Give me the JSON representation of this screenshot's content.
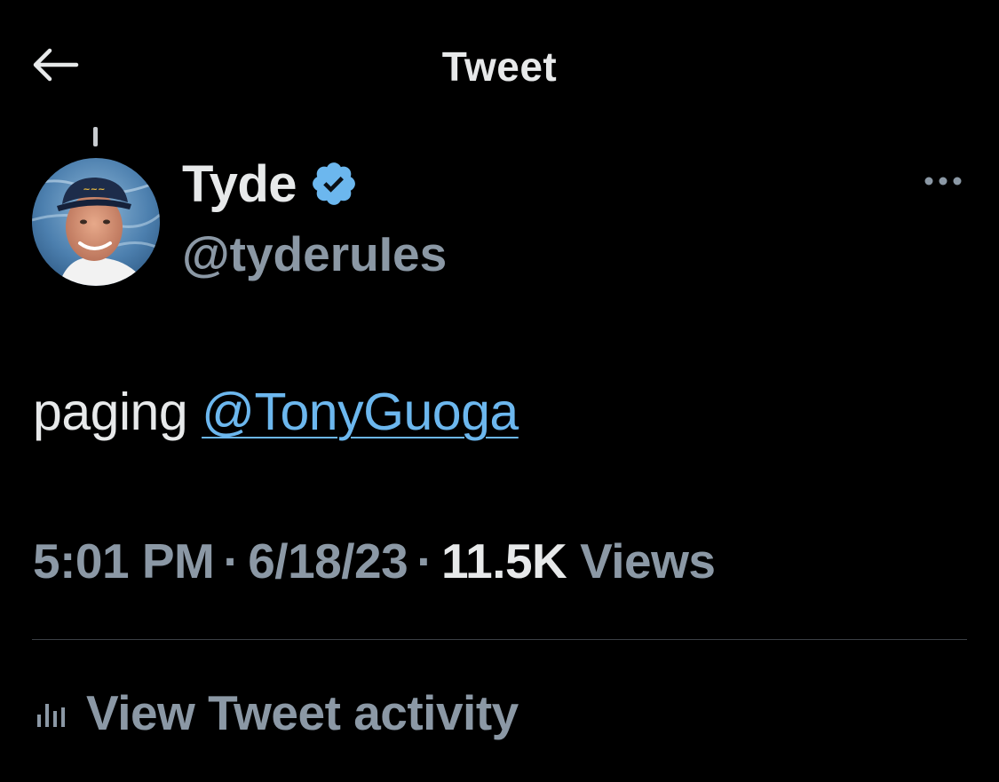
{
  "header": {
    "title": "Tweet",
    "back_icon": "arrow-left-icon"
  },
  "tweet": {
    "author": {
      "name": "Tyde",
      "handle": "@tyderuIes",
      "verified": true,
      "verified_icon": "verified-badge-icon"
    },
    "text_prefix": "paging ",
    "mention": "@TonyGuoga",
    "time": "5:01 PM",
    "date": "6/18/23",
    "separator": "·",
    "views_count": "11.5K",
    "views_label": "Views",
    "more_icon": "more-options-icon"
  },
  "activity": {
    "label": "View Tweet activity",
    "icon": "bar-chart-icon"
  },
  "colors": {
    "background": "#000000",
    "primary_text": "#e7e9ea",
    "secondary_text": "#8b98a5",
    "link": "#6cb7ee",
    "verified": "#6cb7ee",
    "divider": "#3a3f44"
  }
}
